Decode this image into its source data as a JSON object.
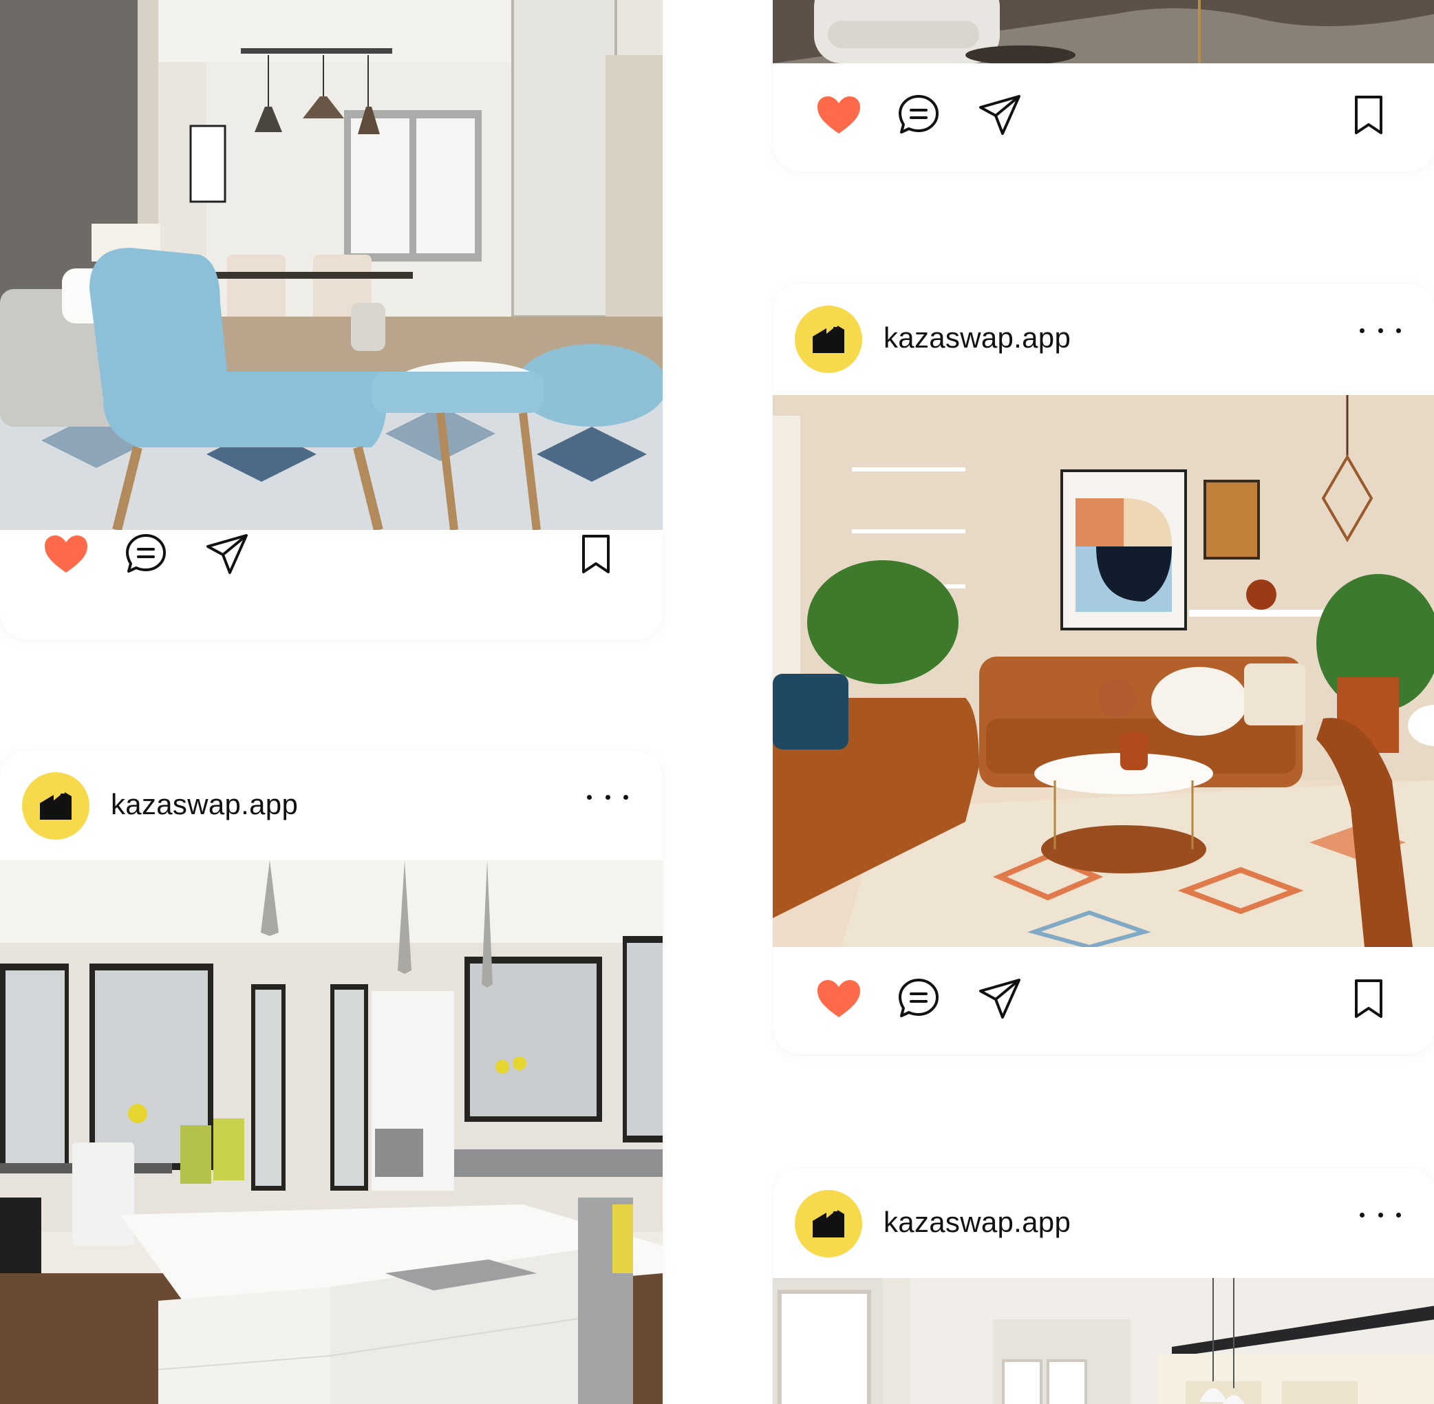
{
  "brand": {
    "accent_color": "#FF6B4A",
    "avatar_color": "#F7D94C",
    "logo_icon": "house-silhouette-icon"
  },
  "posts": [
    {
      "username": "",
      "image": "modern living room with blue armchair and dining area",
      "liked": true
    },
    {
      "username": "kazaswap.app",
      "image": "bright white kitchen with island and large windows",
      "liked": false
    },
    {
      "username": "",
      "image": "luxury living room with white sofa and marble floor",
      "liked": true
    },
    {
      "username": "kazaswap.app",
      "image": "mid-century living room with leather sofas and abstract art",
      "liked": true
    },
    {
      "username": "kazaswap.app",
      "image": "white kitchen with pendant lights and shelves",
      "liked": false
    }
  ],
  "icons": {
    "like": "heart-icon",
    "comment": "comment-bubble-icon",
    "share": "paper-plane-icon",
    "save": "bookmark-icon",
    "more": "more-dots-icon"
  }
}
